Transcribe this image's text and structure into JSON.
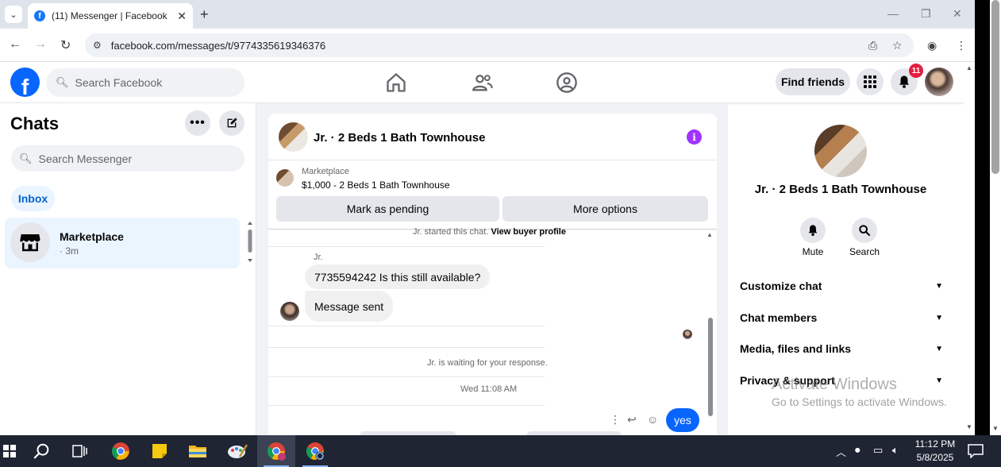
{
  "browser": {
    "tab_title": "(11) Messenger | Facebook",
    "url": "facebook.com/messages/t/9774335619346376"
  },
  "header": {
    "search_placeholder": "Search Facebook",
    "find_friends": "Find friends",
    "notification_count": "11"
  },
  "sidebar": {
    "title": "Chats",
    "search_placeholder": "Search Messenger",
    "filter_tab": "Inbox",
    "chats": [
      {
        "name": "Marketplace",
        "time": "· 3m"
      }
    ]
  },
  "conversation": {
    "title": "Jr. · 2 Beds 1 Bath Townhouse",
    "listing_source": "Marketplace",
    "listing_detail": "$1,000 - 2 Beds 1 Bath Townhouse",
    "mark_pending": "Mark as pending",
    "more_options": "More options",
    "started_text": "Jr. started this chat.",
    "view_profile": "View buyer profile",
    "sender": "Jr.",
    "messages": [
      "7735594242 Is this still available?",
      "Message sent"
    ],
    "waiting_text": "Jr. is waiting for your response.",
    "timestamp": "Wed 11:08 AM",
    "my_reply": "yes"
  },
  "details": {
    "title": "Jr. · 2 Beds 1 Bath Townhouse",
    "mute_label": "Mute",
    "search_label": "Search",
    "sections": [
      "Customize chat",
      "Chat members",
      "Media, files and links",
      "Privacy & support"
    ]
  },
  "watermark": {
    "line1": "Activate Windows",
    "line2": "Go to Settings to activate Windows."
  },
  "taskbar": {
    "time": "11:12 PM",
    "date": "5/8/2025"
  }
}
